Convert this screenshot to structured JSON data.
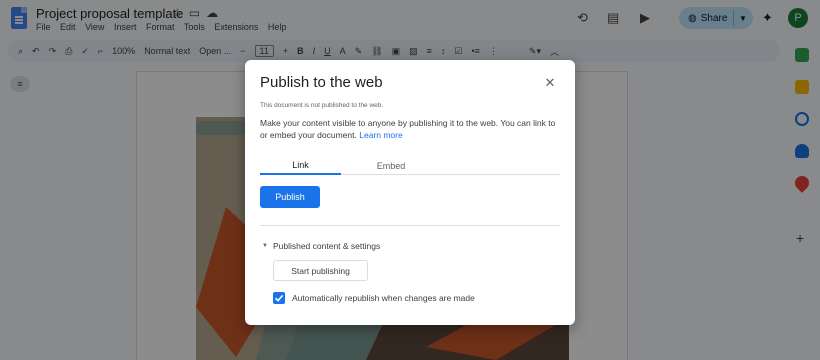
{
  "app": {
    "doc_title": "Project proposal template",
    "menu": [
      "File",
      "Edit",
      "View",
      "Insert",
      "Format",
      "Tools",
      "Extensions",
      "Help"
    ],
    "share_label": "Share",
    "avatar_initial": "P",
    "toolbar": {
      "zoom": "100%",
      "style": "Normal text",
      "font": "Open ...",
      "font_size": "11"
    }
  },
  "dialog": {
    "title": "Publish to the web",
    "status": "This document is not published to the web.",
    "description": "Make your content visible to anyone by publishing it to the web. You can link to or embed your document.",
    "learn_more": "Learn more",
    "tabs": [
      {
        "label": "Link",
        "selected": true
      },
      {
        "label": "Embed",
        "selected": false
      }
    ],
    "publish_label": "Publish",
    "section_label": "Published content & settings",
    "start_publishing_label": "Start publishing",
    "auto_republish_label": "Automatically republish when changes are made",
    "auto_republish_checked": true
  },
  "colors": {
    "accent": "#1a73e8",
    "share_bg": "#c2e7ff",
    "avatar_bg": "#188038"
  }
}
